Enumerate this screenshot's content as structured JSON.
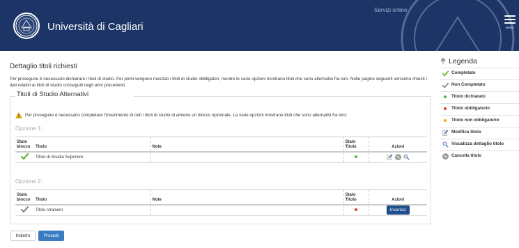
{
  "header": {
    "university_name": "Università di Cagliari",
    "servizi_label": "Servizi online",
    "menu_label": "MENU"
  },
  "page": {
    "title": "Dettaglio titoli richiesti",
    "intro": "Per proseguire è necessario dichiarare i titoli di studio. Per primi vengono mostrati i titoli di studio obbligatori, mentre le varie opzioni mostrano titoli che sono alternativi fra loro. Nelle pagine seguenti verranno chiesti i dati relativi ai titoli di studio conseguiti negli anni precedenti."
  },
  "fieldset": {
    "legend": "Titoli di Studio Alternativi",
    "warning": "Per proseguire è necessario completare l'inserimento di tutti i titoli di studio di almeno un blocco opzionale. Le varie opzioni mostrano titoli che sono alternativi fra loro:"
  },
  "table_headers": {
    "stato_blocco_1": "Stato",
    "stato_blocco_2": "blocco",
    "titolo": "Titolo",
    "note": "Note",
    "stato_titolo_1": "Stato",
    "stato_titolo_2": "Titolo",
    "azioni": "Azioni"
  },
  "options": [
    {
      "label": "Opzione 1:",
      "row": {
        "block_status": "completed",
        "titolo": "Titolo di Scuola Superiore",
        "note": "",
        "title_status": "dichiarato",
        "actions": [
          "modifica-titolo",
          "cancella-titolo",
          "visualizza-dettaglio"
        ]
      }
    },
    {
      "label": "Opzione 2:",
      "row": {
        "block_status": "non-completed",
        "titolo": "Titolo straniero",
        "note": "",
        "title_status": "obbligatorio",
        "action_button": "Inserisci"
      }
    }
  ],
  "buttons": {
    "back": "Indietro",
    "next": "Procedi"
  },
  "sidebar": {
    "title": "Legenda",
    "items": [
      {
        "icon": "green-check-icon",
        "label": "Completato"
      },
      {
        "icon": "gray-check-icon",
        "label": "Non Completato"
      },
      {
        "icon": "green-dot-icon",
        "label": "Titolo dichiarato"
      },
      {
        "icon": "red-dot-icon",
        "label": "Titolo obbligatorio"
      },
      {
        "icon": "orange-dot-icon",
        "label": "Titolo non obbligatorio"
      },
      {
        "icon": "edit-icon",
        "label": "Modifica titolo"
      },
      {
        "icon": "magnifier-icon",
        "label": "Visualizza dettaglio titolo"
      },
      {
        "icon": "delete-icon",
        "label": "Cancella titolo"
      }
    ]
  },
  "colors": {
    "header_bg": "#1c3566",
    "accent_blue": "#3a7cc2",
    "dot_green": "#4caf50",
    "dot_red": "#e53935",
    "dot_orange": "#f5a623"
  }
}
